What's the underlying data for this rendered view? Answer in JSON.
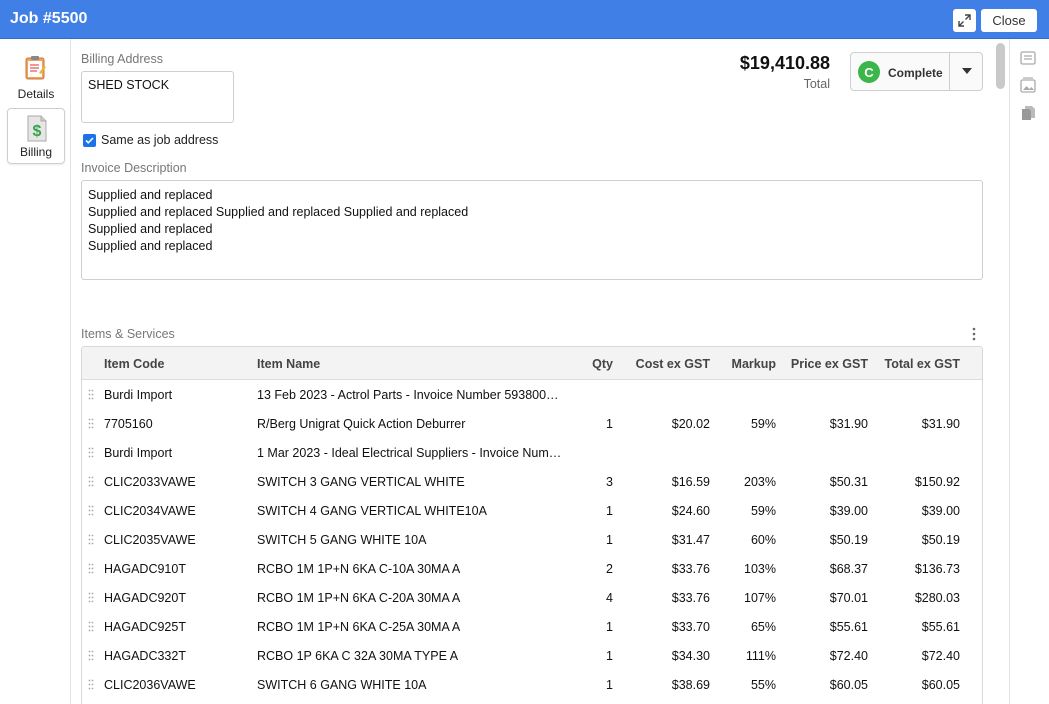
{
  "window": {
    "title": "Job #5500",
    "close_label": "Close"
  },
  "nav": {
    "items": [
      {
        "label": "Details",
        "icon": "clipboard-icon"
      },
      {
        "label": "Billing",
        "icon": "money-doc-icon"
      }
    ]
  },
  "billing": {
    "address_label": "Billing Address",
    "address_value": "SHED STOCK",
    "same_as_job_label": "Same as job address",
    "same_as_job_checked": true,
    "total_amount": "$19,410.88",
    "total_label": "Total",
    "status": {
      "letter": "C",
      "label": "Complete",
      "color": "#3cb54a"
    },
    "invoice_description_label": "Invoice Description",
    "invoice_description_lines": [
      "Supplied and replaced",
      "Supplied and replaced Supplied and replaced Supplied and replaced",
      "Supplied and replaced",
      "Supplied and replaced"
    ]
  },
  "items": {
    "section_label": "Items & Services",
    "columns": [
      "Item Code",
      "Item Name",
      "Qty",
      "Cost ex GST",
      "Markup",
      "Price ex GST",
      "Total ex GST"
    ],
    "rows": [
      [
        "Burdi Import",
        "13 Feb 2023 - Actrol Parts - Invoice Number 593800…",
        "",
        "",
        "",
        "",
        ""
      ],
      [
        "7705160",
        "R/Berg Unigrat Quick Action Deburrer",
        "1",
        "$20.02",
        "59%",
        "$31.90",
        "$31.90"
      ],
      [
        "Burdi Import",
        "1 Mar 2023 - Ideal Electrical Suppliers - Invoice Num…",
        "",
        "",
        "",
        "",
        ""
      ],
      [
        "CLIC2033VAWE",
        "SWITCH 3 GANG VERTICAL WHITE",
        "3",
        "$16.59",
        "203%",
        "$50.31",
        "$150.92"
      ],
      [
        "CLIC2034VAWE",
        "SWITCH 4 GANG VERTICAL WHITE10A",
        "1",
        "$24.60",
        "59%",
        "$39.00",
        "$39.00"
      ],
      [
        "CLIC2035VAWE",
        "SWITCH 5 GANG WHITE 10A",
        "1",
        "$31.47",
        "60%",
        "$50.19",
        "$50.19"
      ],
      [
        "HAGADC910T",
        "RCBO 1M 1P+N 6KA C-10A 30MA A",
        "2",
        "$33.76",
        "103%",
        "$68.37",
        "$136.73"
      ],
      [
        "HAGADC920T",
        "RCBO 1M 1P+N 6KA C-20A 30MA A",
        "4",
        "$33.76",
        "107%",
        "$70.01",
        "$280.03"
      ],
      [
        "HAGADC925T",
        "RCBO 1M 1P+N 6KA C-25A 30MA A",
        "1",
        "$33.70",
        "65%",
        "$55.61",
        "$55.61"
      ],
      [
        "HAGADC332T",
        "RCBO 1P 6KA C 32A 30MA TYPE A",
        "1",
        "$34.30",
        "111%",
        "$72.40",
        "$72.40"
      ],
      [
        "CLIC2036VAWE",
        "SWITCH 6 GANG WHITE 10A",
        "1",
        "$38.69",
        "55%",
        "$60.05",
        "$60.05"
      ]
    ]
  },
  "right_sidebar": {
    "icons": [
      "notes-icon",
      "gallery-icon",
      "copy-docs-icon"
    ]
  }
}
